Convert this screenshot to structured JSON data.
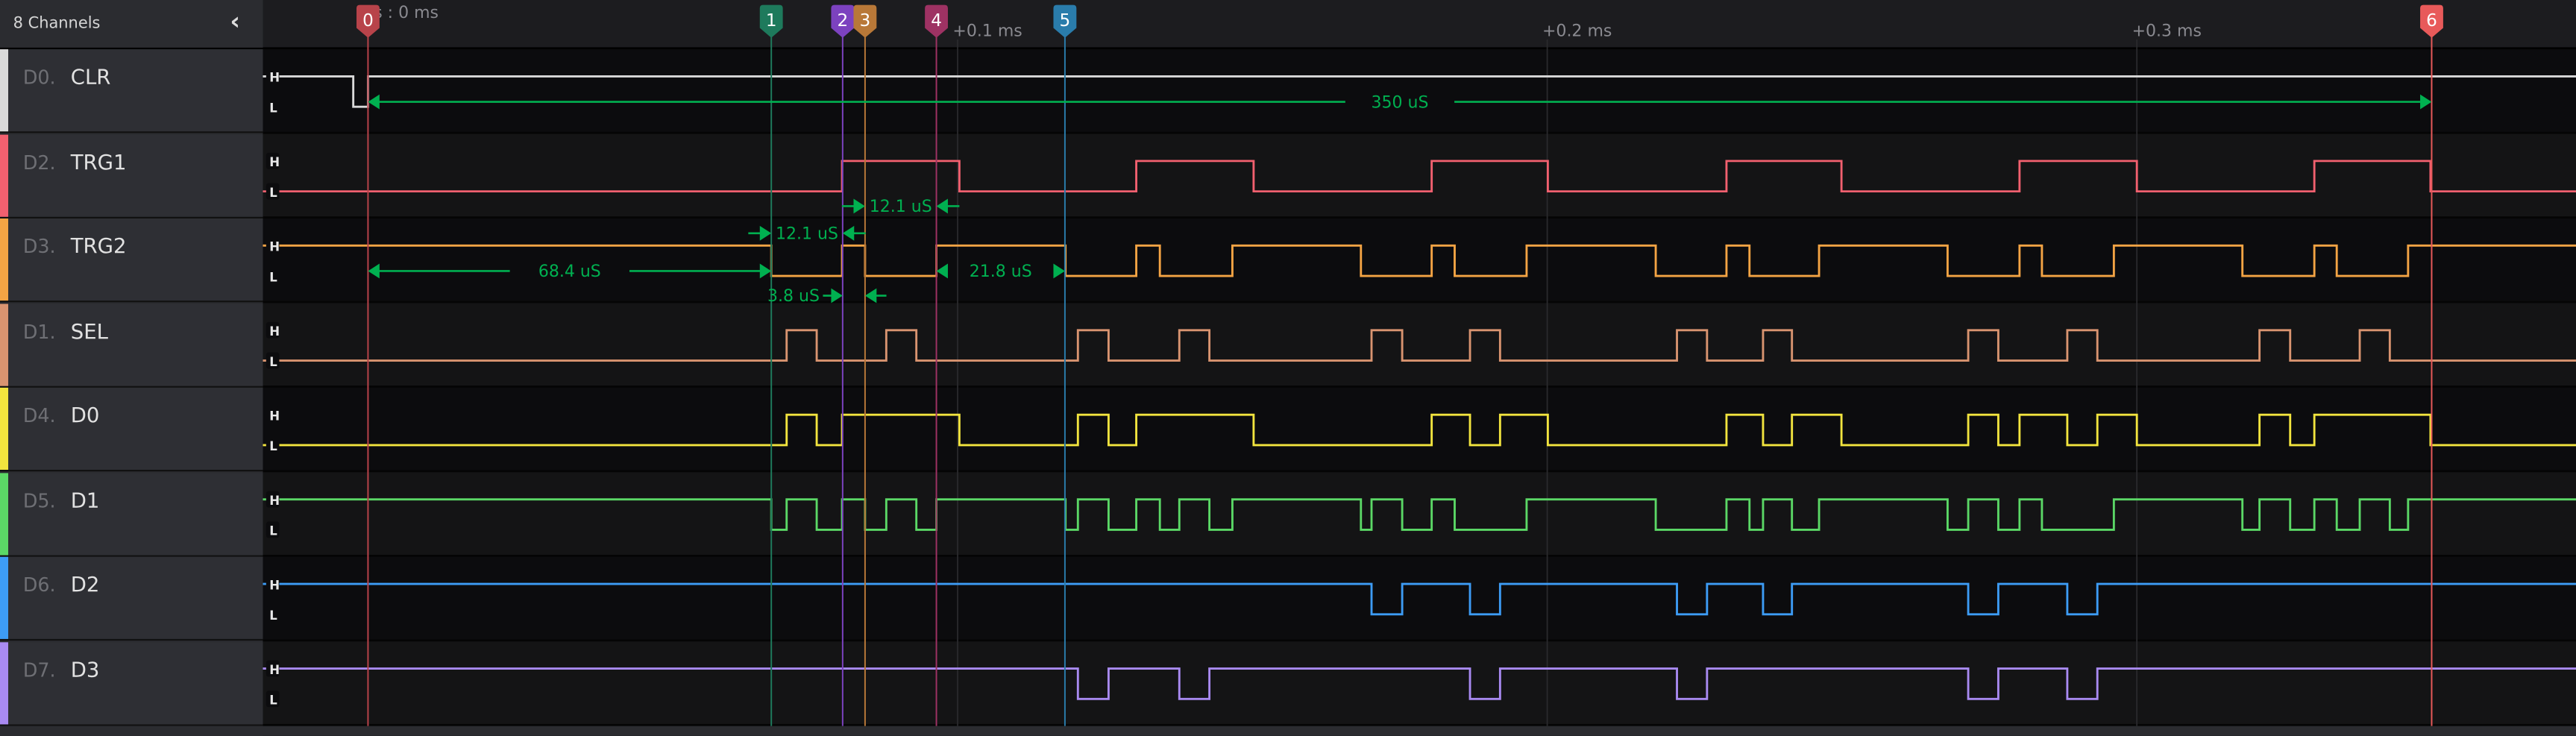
{
  "sidebar": {
    "title": "8 Channels",
    "collapse_icon": "chevron-left-icon"
  },
  "level_labels": {
    "high": "H",
    "low": "L"
  },
  "time_unit": "us",
  "timeline": {
    "labels": [
      {
        "t": 0,
        "text": "0 s : 0 ms"
      },
      {
        "t": 100,
        "text": "+0.1 ms"
      },
      {
        "t": 200,
        "text": "+0.2 ms"
      },
      {
        "t": 300,
        "text": "+0.3 ms"
      }
    ]
  },
  "channels": [
    {
      "id": "D0.",
      "name": "CLR",
      "color": "#d9d9d9",
      "initial": 1,
      "transitions": [
        -2.5,
        0
      ]
    },
    {
      "id": "D2.",
      "name": "TRG1",
      "color": "#f2606f",
      "initial": 0,
      "transitions": [
        80.4,
        100.3,
        130.3,
        150.2,
        180.4,
        200.1,
        230.4,
        249.9,
        280.1,
        300.0,
        330.1,
        349.8
      ]
    },
    {
      "id": "D3.",
      "name": "TRG2",
      "color": "#f4a444",
      "initial": 1,
      "transitions": [
        68.4,
        80.4,
        84.3,
        96.4,
        118.3,
        130.3,
        134.3,
        146.6,
        168.4,
        180.4,
        184.3,
        196.5,
        218.4,
        230.4,
        234.3,
        246.1,
        267.9,
        280.1,
        283.9,
        296.1,
        317.9,
        330.1,
        333.9,
        346.0
      ]
    },
    {
      "id": "D1.",
      "name": "SEL",
      "color": "#d99470",
      "initial": 0,
      "transitions": [
        71.0,
        76.1,
        87.9,
        93.0,
        120.4,
        125.6,
        137.6,
        142.7,
        170.2,
        175.4,
        186.9,
        192.0,
        222.0,
        227.1,
        236.6,
        241.5,
        271.4,
        276.5,
        288.2,
        293.3,
        320.8,
        326.0,
        337.8,
        342.9
      ]
    },
    {
      "id": "D4.",
      "name": "D0",
      "color": "#f2e43e",
      "initial": 0,
      "transitions": [
        71.0,
        76.1,
        80.4,
        100.3,
        120.4,
        125.6,
        130.3,
        150.2,
        180.4,
        186.9,
        192.0,
        200.1,
        230.4,
        236.6,
        241.5,
        249.9,
        271.4,
        276.5,
        280.1,
        288.2,
        293.3,
        300.0,
        320.8,
        326.0,
        330.1,
        349.8
      ]
    },
    {
      "id": "D5.",
      "name": "D1",
      "color": "#5bd866",
      "initial": 1,
      "transitions": [
        68.4,
        71.0,
        76.1,
        80.4,
        84.3,
        87.9,
        93.0,
        96.4,
        118.3,
        120.4,
        125.6,
        130.3,
        134.3,
        137.6,
        142.7,
        146.6,
        168.4,
        170.2,
        175.4,
        180.4,
        184.3,
        196.5,
        218.4,
        230.4,
        234.3,
        236.6,
        241.5,
        246.1,
        267.9,
        271.4,
        276.5,
        280.1,
        283.9,
        296.1,
        317.9,
        320.8,
        326.0,
        330.1,
        333.9,
        337.8,
        342.9,
        346.0
      ]
    },
    {
      "id": "D6.",
      "name": "D2",
      "color": "#3d9cf5",
      "initial": 1,
      "transitions": [
        170.2,
        175.4,
        186.9,
        192.0,
        222.0,
        227.1,
        236.6,
        241.5,
        271.4,
        276.5,
        288.2,
        293.3
      ]
    },
    {
      "id": "D7.",
      "name": "D3",
      "color": "#a98af2",
      "initial": 1,
      "transitions": [
        120.4,
        125.6,
        137.6,
        142.7,
        186.9,
        192.0,
        222.0,
        227.1,
        271.4,
        276.5,
        288.2,
        293.3
      ]
    }
  ],
  "markers": [
    {
      "label": "0",
      "t": 0,
      "color": "#b8434a"
    },
    {
      "label": "1",
      "t": 68.4,
      "color": "#1e7a5c"
    },
    {
      "label": "2",
      "t": 80.5,
      "color": "#7c42bf"
    },
    {
      "label": "3",
      "t": 84.3,
      "color": "#b87838"
    },
    {
      "label": "4",
      "t": 96.4,
      "color": "#9e3263"
    },
    {
      "label": "5",
      "t": 118.2,
      "color": "#2a7cab"
    },
    {
      "label": "6",
      "t": 350,
      "color": "#e85a5a"
    }
  ],
  "measurement_color": "#00b050",
  "measurements": [
    {
      "channel": 0,
      "lane": "middle",
      "t1": 0,
      "t2": 350,
      "label": "350 uS",
      "style": "span"
    },
    {
      "channel": 1,
      "lane": "lower",
      "t1": 84.3,
      "t2": 96.4,
      "label": "12.1 uS",
      "style": "inward"
    },
    {
      "channel": 2,
      "lane": "top",
      "t1": 68.4,
      "t2": 80.5,
      "label": "12.1 uS",
      "style": "inward"
    },
    {
      "channel": 2,
      "lane": "middle",
      "t1": 0,
      "t2": 68.4,
      "label": "68.4 uS",
      "style": "span"
    },
    {
      "channel": 2,
      "lane": "middle",
      "t1": 96.4,
      "t2": 118.2,
      "label": "21.8 uS",
      "style": "span"
    },
    {
      "channel": 2,
      "lane": "bottom",
      "t1": 80.5,
      "t2": 84.3,
      "label": "3.8 uS",
      "style": "inward-left-label"
    }
  ]
}
